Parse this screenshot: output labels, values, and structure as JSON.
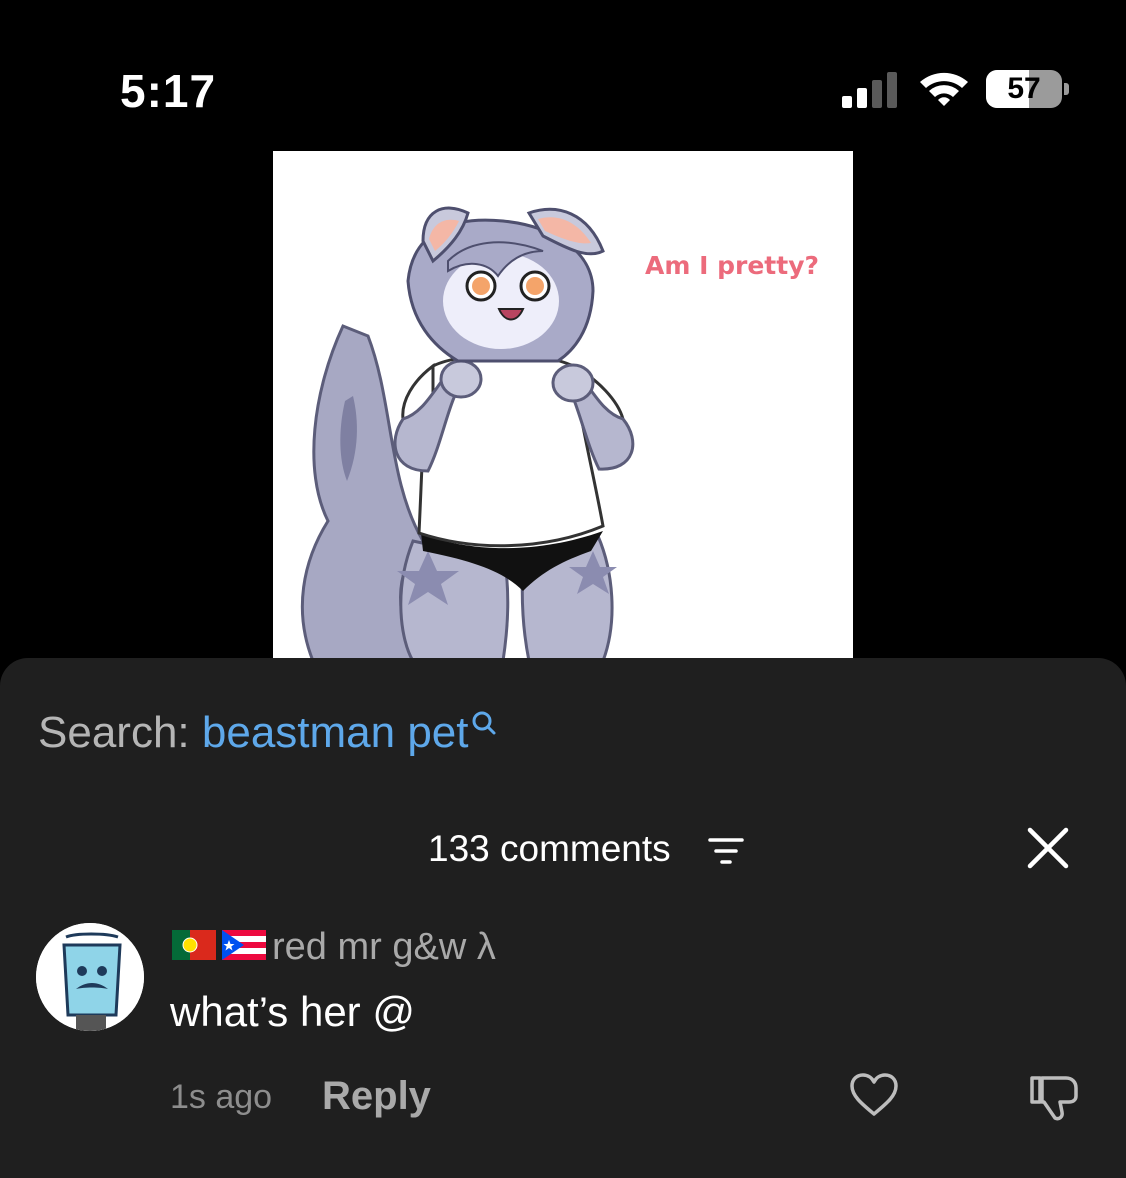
{
  "status_bar": {
    "time": "5:17",
    "battery_level": "57",
    "battery_fraction": 0.57,
    "icons": [
      "signal-icon",
      "wifi-icon",
      "battery-icon"
    ]
  },
  "video": {
    "overlay_caption": "Am I pretty?",
    "caption_color": "#ec6b7c"
  },
  "search": {
    "prefix": "Search: ",
    "term": "beastman pet",
    "term_color": "#5ea8ea"
  },
  "comments_header": {
    "count_label": "133 comments",
    "icons": [
      "filter-icon",
      "close-icon"
    ]
  },
  "comments": [
    {
      "flags": [
        "portugal-flag-icon",
        "puerto-rico-flag-icon"
      ],
      "author": "red mr g&w λ",
      "text": "what’s her @",
      "time": "1s ago",
      "reply_label": "Reply",
      "icons": [
        "heart-icon",
        "thumbs-down-icon"
      ]
    }
  ],
  "colors": {
    "background": "#000000",
    "sheet": "#1f1f1f",
    "link": "#5ea8ea"
  }
}
